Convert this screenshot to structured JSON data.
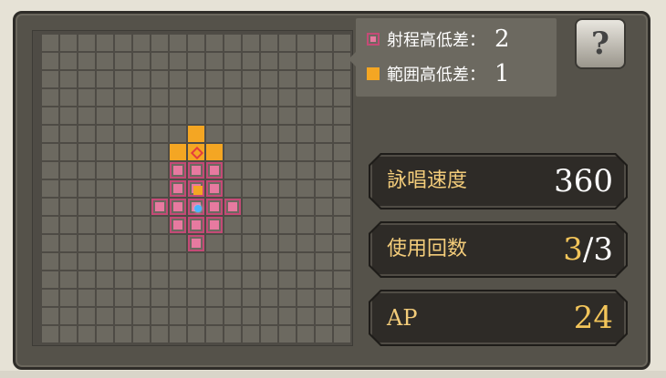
{
  "legend": {
    "range_height_label": "射程高低差：",
    "range_height_value": "2",
    "area_height_label": "範囲高低差：",
    "area_height_value": "1"
  },
  "help_button": {
    "label": "?",
    "icon": "question-book-icon"
  },
  "stats": {
    "cast_speed_label": "詠唱速度",
    "cast_speed_value": "360",
    "uses_label": "使用回数",
    "uses_current": "3",
    "uses_separator": "/",
    "uses_max": "3",
    "ap_label": "AP",
    "ap_value": "24"
  },
  "colors": {
    "range": "#e77aa0",
    "area": "#f4a623",
    "caster": "#4bb4ff",
    "label_gold": "#f3cc7a"
  },
  "range_grid": {
    "columns": 17,
    "rows": 17,
    "area_cells": [
      [
        8,
        5
      ],
      [
        7,
        6
      ],
      [
        8,
        6
      ],
      [
        9,
        6
      ]
    ],
    "range_cells": [
      [
        8,
        7
      ],
      [
        7,
        8
      ],
      [
        8,
        8
      ],
      [
        9,
        8
      ],
      [
        6,
        9
      ],
      [
        7,
        9
      ],
      [
        8,
        9
      ],
      [
        9,
        9
      ],
      [
        10,
        9
      ],
      [
        7,
        10
      ],
      [
        8,
        10
      ],
      [
        9,
        10
      ],
      [
        8,
        11
      ],
      [
        9,
        7
      ],
      [
        7,
        7
      ]
    ],
    "target_cell": [
      8,
      6
    ],
    "inner_area_cell": [
      8,
      8
    ],
    "caster_cell": [
      8,
      9
    ]
  }
}
